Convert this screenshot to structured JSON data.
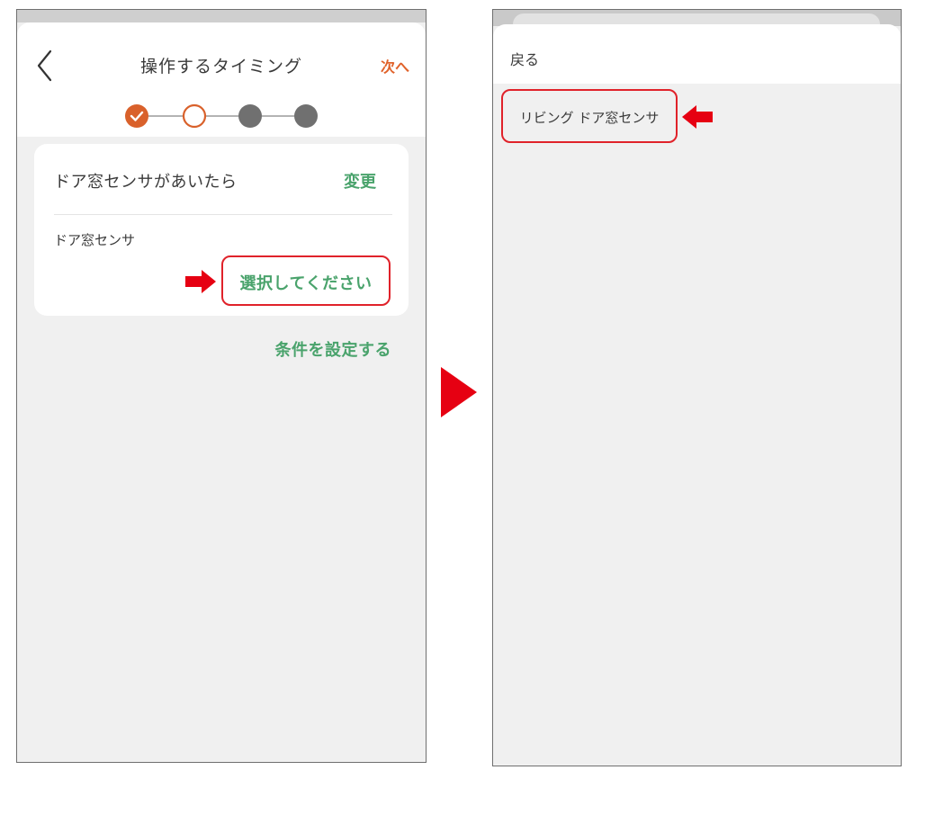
{
  "screen1": {
    "title": "操作するタイミング",
    "next_label": "次へ",
    "stepper": {
      "total_steps": 4,
      "current_step": 2,
      "completed_steps": 1
    },
    "card": {
      "title": "ドア窓センサがあいたら",
      "change_label": "変更",
      "field_label": "ドア窓センサ",
      "select_placeholder": "選択してください"
    },
    "set_conditions_label": "条件を設定する"
  },
  "screen2": {
    "back_label": "戻る",
    "list_items": [
      {
        "label": "リビング ドア窓センサ"
      }
    ]
  },
  "icons": {
    "back": "chevron-left-icon",
    "check": "check-icon",
    "pointer_right": "arrow-right-icon",
    "pointer_left": "arrow-left-icon",
    "transition": "triangle-right-icon"
  },
  "colors": {
    "accent_orange": "#d9612b",
    "accent_green": "#4aa36c",
    "highlight_red": "#e0222a",
    "step_inactive": "#707070"
  }
}
